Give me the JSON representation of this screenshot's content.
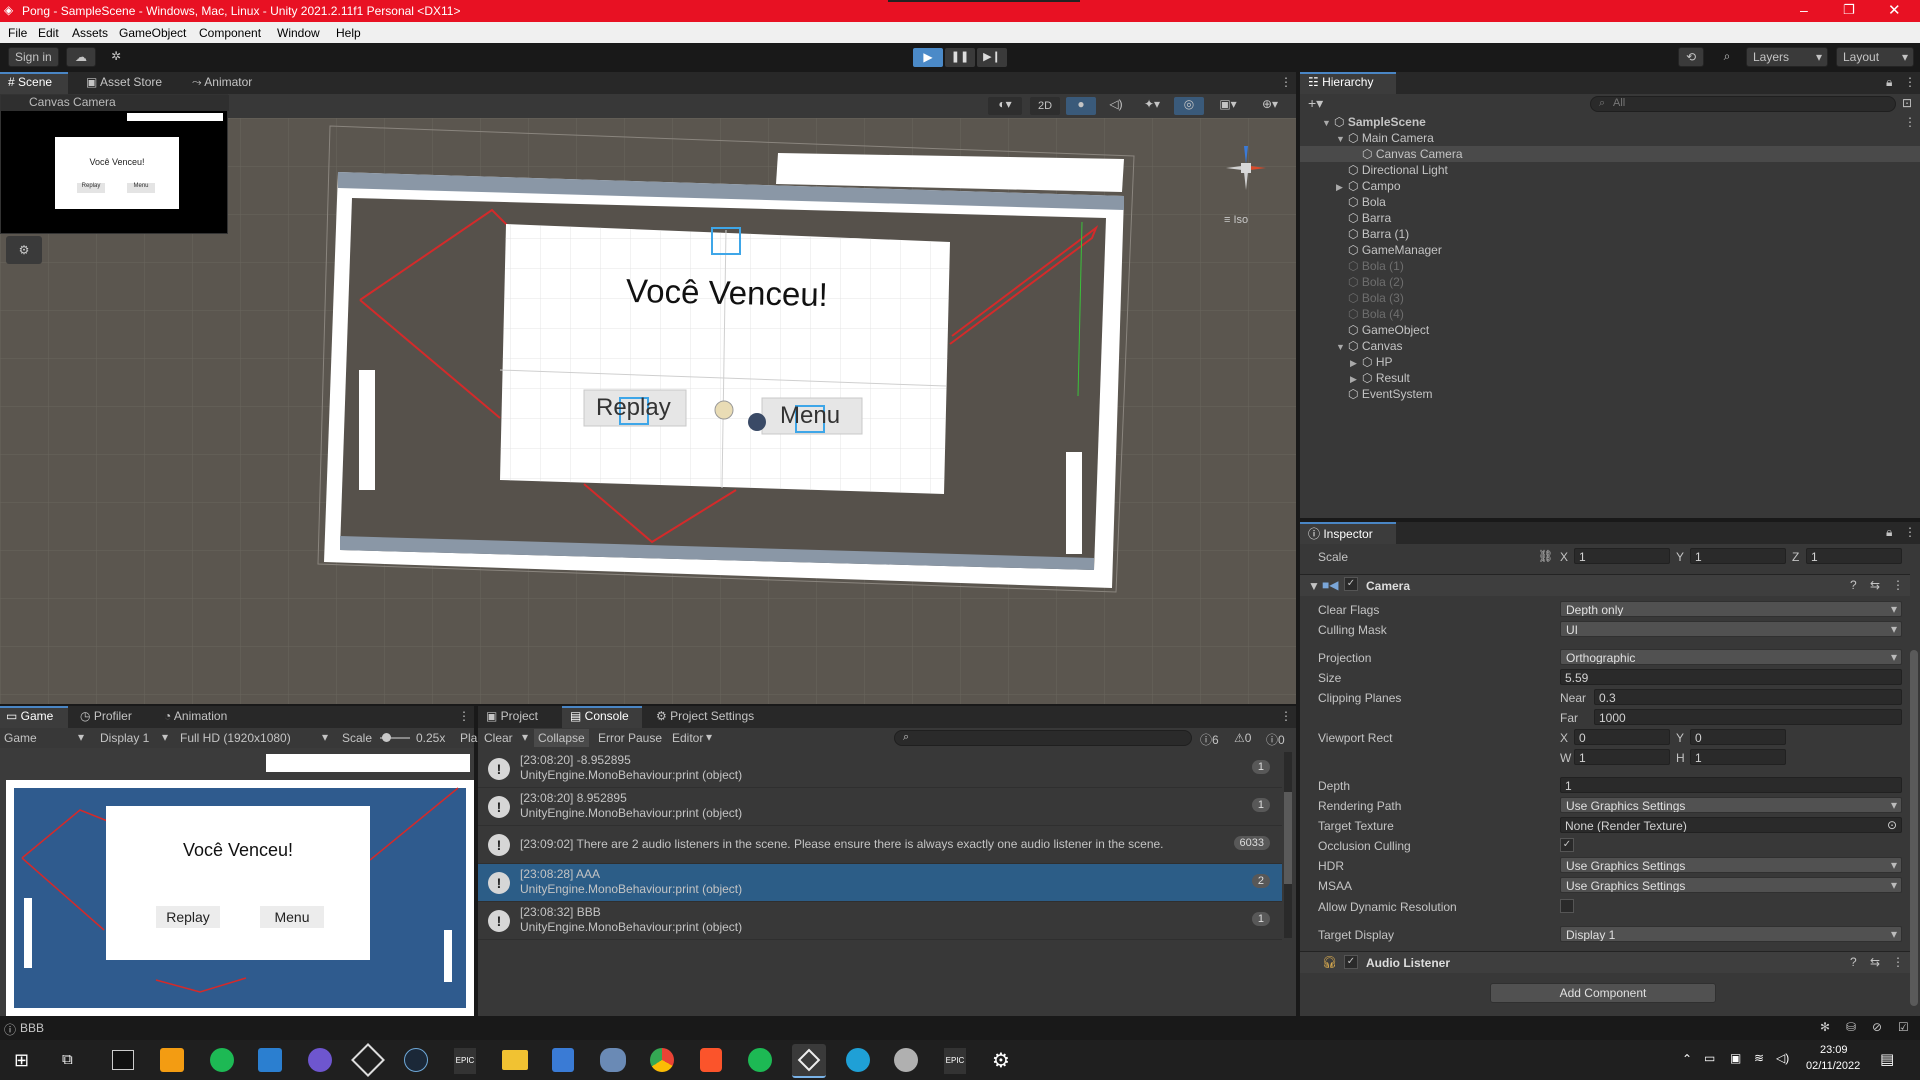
{
  "window": {
    "title": "Pong - SampleScene - Windows, Mac, Linux - Unity 2021.2.11f1 Personal <DX11>"
  },
  "menu": [
    "File",
    "Edit",
    "Assets",
    "GameObject",
    "Component",
    "Window",
    "Help"
  ],
  "toolbar": {
    "sign_in": "Sign in",
    "layers": "Layers",
    "layout": "Layout"
  },
  "scene_view": {
    "tabs": [
      "Scene",
      "Asset Store",
      "Animator"
    ],
    "active_tab": "Scene",
    "mode_2d": "2D",
    "iso_label": "Iso",
    "camera_preview_title": "Canvas Camera",
    "preview_title": "Você Venceu!",
    "preview_replay": "Replay",
    "preview_menu": "Menu",
    "title_text": "Você Venceu!",
    "replay_text": "Replay",
    "menu_text": "Menu"
  },
  "game_view": {
    "tabs": [
      "Game",
      "Profiler",
      "Animation"
    ],
    "active_tab": "Game",
    "game_dropdown": "Game",
    "display_dropdown": "Display 1",
    "resolution_dropdown": "Full HD (1920x1080)",
    "scale_label": "Scale",
    "scale_value": "0.25x",
    "play_label": "Pla",
    "title_text": "Você Venceu!",
    "replay_text": "Replay",
    "menu_text": "Menu"
  },
  "console": {
    "tabs": [
      "Project",
      "Console",
      "Project Settings"
    ],
    "active_tab": "Console",
    "clear": "Clear",
    "collapse": "Collapse",
    "error_pause": "Error Pause",
    "editor": "Editor",
    "count_info": "6",
    "count_warn": "0",
    "count_error": "0",
    "logs": [
      {
        "line1": "[23:08:20] -8.952895",
        "line2": "UnityEngine.MonoBehaviour:print (object)",
        "count": "1",
        "selected": false
      },
      {
        "line1": "[23:08:20] 8.952895",
        "line2": "UnityEngine.MonoBehaviour:print (object)",
        "count": "1",
        "selected": false
      },
      {
        "line1": "[23:09:02] There are 2 audio listeners in the scene. Please ensure there is always exactly one audio listener in the scene.",
        "line2": "",
        "count": "6033",
        "selected": false
      },
      {
        "line1": "[23:08:28] AAA",
        "line2": "UnityEngine.MonoBehaviour:print (object)",
        "count": "2",
        "selected": true
      },
      {
        "line1": "[23:08:32] BBB",
        "line2": "UnityEngine.MonoBehaviour:print (object)",
        "count": "1",
        "selected": false
      }
    ]
  },
  "hierarchy": {
    "tab": "Hierarchy",
    "search_placeholder": "All",
    "items": [
      {
        "label": "SampleScene",
        "depth": 0,
        "disabled": false,
        "arrow": "▼",
        "bold": true
      },
      {
        "label": "Main Camera",
        "depth": 1,
        "disabled": false,
        "arrow": "▼",
        "bold": false
      },
      {
        "label": "Canvas Camera",
        "depth": 2,
        "disabled": false,
        "arrow": "",
        "bold": false,
        "selected": true
      },
      {
        "label": "Directional Light",
        "depth": 1,
        "disabled": false,
        "arrow": "",
        "bold": false
      },
      {
        "label": "Campo",
        "depth": 1,
        "disabled": false,
        "arrow": "▶",
        "bold": false
      },
      {
        "label": "Bola",
        "depth": 1,
        "disabled": false,
        "arrow": "",
        "bold": false
      },
      {
        "label": "Barra",
        "depth": 1,
        "disabled": false,
        "arrow": "",
        "bold": false
      },
      {
        "label": "Barra (1)",
        "depth": 1,
        "disabled": false,
        "arrow": "",
        "bold": false
      },
      {
        "label": "GameManager",
        "depth": 1,
        "disabled": false,
        "arrow": "",
        "bold": false
      },
      {
        "label": "Bola (1)",
        "depth": 1,
        "disabled": true,
        "arrow": "",
        "bold": false
      },
      {
        "label": "Bola (2)",
        "depth": 1,
        "disabled": true,
        "arrow": "",
        "bold": false
      },
      {
        "label": "Bola (3)",
        "depth": 1,
        "disabled": true,
        "arrow": "",
        "bold": false
      },
      {
        "label": "Bola (4)",
        "depth": 1,
        "disabled": true,
        "arrow": "",
        "bold": false
      },
      {
        "label": "GameObject",
        "depth": 1,
        "disabled": false,
        "arrow": "",
        "bold": false
      },
      {
        "label": "Canvas",
        "depth": 1,
        "disabled": false,
        "arrow": "▼",
        "bold": false
      },
      {
        "label": "HP",
        "depth": 2,
        "disabled": false,
        "arrow": "▶",
        "bold": false
      },
      {
        "label": "Result",
        "depth": 2,
        "disabled": false,
        "arrow": "▶",
        "bold": false
      },
      {
        "label": "EventSystem",
        "depth": 1,
        "disabled": false,
        "arrow": "",
        "bold": false
      }
    ]
  },
  "inspector": {
    "tab": "Inspector",
    "scale_label": "Scale",
    "scale_x": "1",
    "scale_y": "1",
    "scale_z": "1",
    "camera_header": "Camera",
    "clear_flags_label": "Clear Flags",
    "clear_flags": "Depth only",
    "culling_mask_label": "Culling Mask",
    "culling_mask": "UI",
    "projection_label": "Projection",
    "projection": "Orthographic",
    "size_label": "Size",
    "size": "5.59",
    "clipping_label": "Clipping Planes",
    "near_label": "Near",
    "near": "0.3",
    "far_label": "Far",
    "far": "1000",
    "viewport_label": "Viewport Rect",
    "vx": "0",
    "vy": "0",
    "vw": "1",
    "vh": "1",
    "depth_label": "Depth",
    "depth": "1",
    "rendering_path_label": "Rendering Path",
    "rendering_path": "Use Graphics Settings",
    "target_texture_label": "Target Texture",
    "target_texture": "None (Render Texture)",
    "occlusion_label": "Occlusion Culling",
    "hdr_label": "HDR",
    "hdr": "Use Graphics Settings",
    "msaa_label": "MSAA",
    "msaa": "Use Graphics Settings",
    "dynamic_res_label": "Allow Dynamic Resolution",
    "target_display_label": "Target Display",
    "target_display": "Display 1",
    "audio_listener_header": "Audio Listener",
    "add_component": "Add Component"
  },
  "statusbar": {
    "message": "BBB"
  },
  "taskbar": {
    "time": "23:09",
    "date": "02/11/2022"
  },
  "colors": {
    "title_bar": "#e81123",
    "game_bg": "#2f5b8e",
    "selection": "#2c5d87",
    "scene_bg": "#5b564f"
  }
}
